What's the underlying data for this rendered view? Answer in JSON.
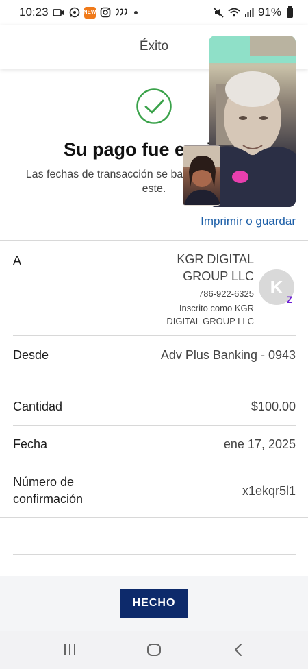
{
  "status_bar": {
    "time": "10:23",
    "battery": "91%",
    "app_badge": "NEW"
  },
  "header": {
    "title": "Éxito"
  },
  "success": {
    "title": "Su pago fue enviado",
    "subtitle": "Las fechas de transacción se basan en el horario del este.",
    "print_link": "Imprimir o guardar"
  },
  "details": {
    "to": {
      "label": "A",
      "name_line1": "KGR DIGITAL",
      "name_line2": "GROUP LLC",
      "phone": "786-922-6325",
      "enrolled_line1": "Inscrito como KGR",
      "enrolled_line2": "DIGITAL GROUP LLC",
      "avatar_initial": "K",
      "badge": "Z"
    },
    "from": {
      "label": "Desde",
      "value": "Adv Plus Banking - 0943"
    },
    "amount": {
      "label": "Cantidad",
      "value": "$100.00"
    },
    "date": {
      "label": "Fecha",
      "value": "ene 17, 2025"
    },
    "confirmation": {
      "label_line1": "Número de",
      "label_line2": "confirmación",
      "value": "x1ekqr5l1"
    }
  },
  "actions": {
    "done_label": "HECHO"
  },
  "colors": {
    "accent": "#0d2a6b",
    "link": "#1d5fa8",
    "success_green": "#3aa24a",
    "zelle_purple": "#6d1ed4"
  },
  "icons": {
    "check": "check-circle-icon",
    "nav_recents": "recents-icon",
    "nav_home": "home-icon",
    "nav_back": "back-icon"
  }
}
